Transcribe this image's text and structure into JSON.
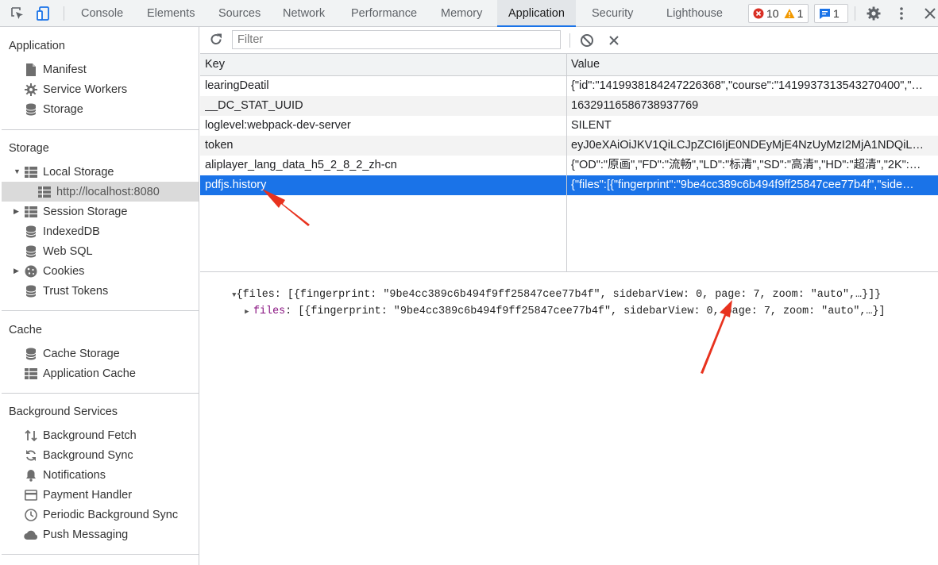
{
  "toolbar": {
    "tabs": [
      "Console",
      "Elements",
      "Sources",
      "Network",
      "Performance",
      "Memory",
      "Application",
      "Security",
      "Lighthouse"
    ],
    "active_tab": "Application",
    "errors_count": "10",
    "warnings_count": "1",
    "messages_count": "1"
  },
  "sidebar": {
    "application": {
      "title": "Application",
      "items": [
        "Manifest",
        "Service Workers",
        "Storage"
      ]
    },
    "storage": {
      "title": "Storage",
      "local_storage": "Local Storage",
      "local_origin": "http://localhost:8080",
      "items": [
        "Session Storage",
        "IndexedDB",
        "Web SQL",
        "Cookies",
        "Trust Tokens"
      ]
    },
    "cache": {
      "title": "Cache",
      "items": [
        "Cache Storage",
        "Application Cache"
      ]
    },
    "background": {
      "title": "Background Services",
      "items": [
        "Background Fetch",
        "Background Sync",
        "Notifications",
        "Payment Handler",
        "Periodic Background Sync",
        "Push Messaging"
      ]
    }
  },
  "filter": {
    "placeholder": "Filter",
    "value": ""
  },
  "table": {
    "columns": [
      "Key",
      "Value"
    ],
    "rows": [
      {
        "key": "learingDeatil",
        "value": "{\"id\":\"1419938184247226368\",\"course\":\"1419937313543270400\",\"…"
      },
      {
        "key": "__DC_STAT_UUID",
        "value": "16329116586738937769"
      },
      {
        "key": "loglevel:webpack-dev-server",
        "value": "SILENT"
      },
      {
        "key": "token",
        "value": "eyJ0eXAiOiJKV1QiLCJpZCI6IjE0NDEyMjE4NzUyMzI2MjA1NDQiLCJ…"
      },
      {
        "key": "aliplayer_lang_data_h5_2_8_2_zh-cn",
        "value": "{\"OD\":\"原画\",\"FD\":\"流畅\",\"LD\":\"标清\",\"SD\":\"高清\",\"HD\":\"超清\",\"2K\":…"
      },
      {
        "key": "pdfjs.history",
        "value": "{\"files\":[{\"fingerprint\":\"9be4cc389c6b494f9ff25847cee77b4f\",\"side…"
      }
    ],
    "selected_index": 5
  },
  "preview": {
    "line1": "{files: [{fingerprint: \"9be4cc389c6b494f9ff25847cee77b4f\", sidebarView: 0, page: 7, zoom: \"auto\",…}]}",
    "line2_key": "files",
    "line2_rest": ": [{fingerprint: \"9be4cc389c6b494f9ff25847cee77b4f\", sidebarView: 0, page: 7, zoom: \"auto\",…}]"
  },
  "colors": {
    "accent": "#1a73e8",
    "annotation": "#e8321e",
    "error": "#d93025",
    "warning": "#f29900"
  },
  "icons": [
    "inspect-icon",
    "device-toggle-icon",
    "error-icon",
    "warning-icon",
    "message-icon",
    "gear-icon",
    "more-icon",
    "close-icon",
    "refresh-icon",
    "clear-icon",
    "delete-icon",
    "manifest-icon",
    "service-workers-icon",
    "database-icon",
    "table-icon",
    "cookie-icon",
    "fetch-icon",
    "sync-icon",
    "bell-icon",
    "card-icon",
    "clock-icon",
    "cloud-icon"
  ]
}
